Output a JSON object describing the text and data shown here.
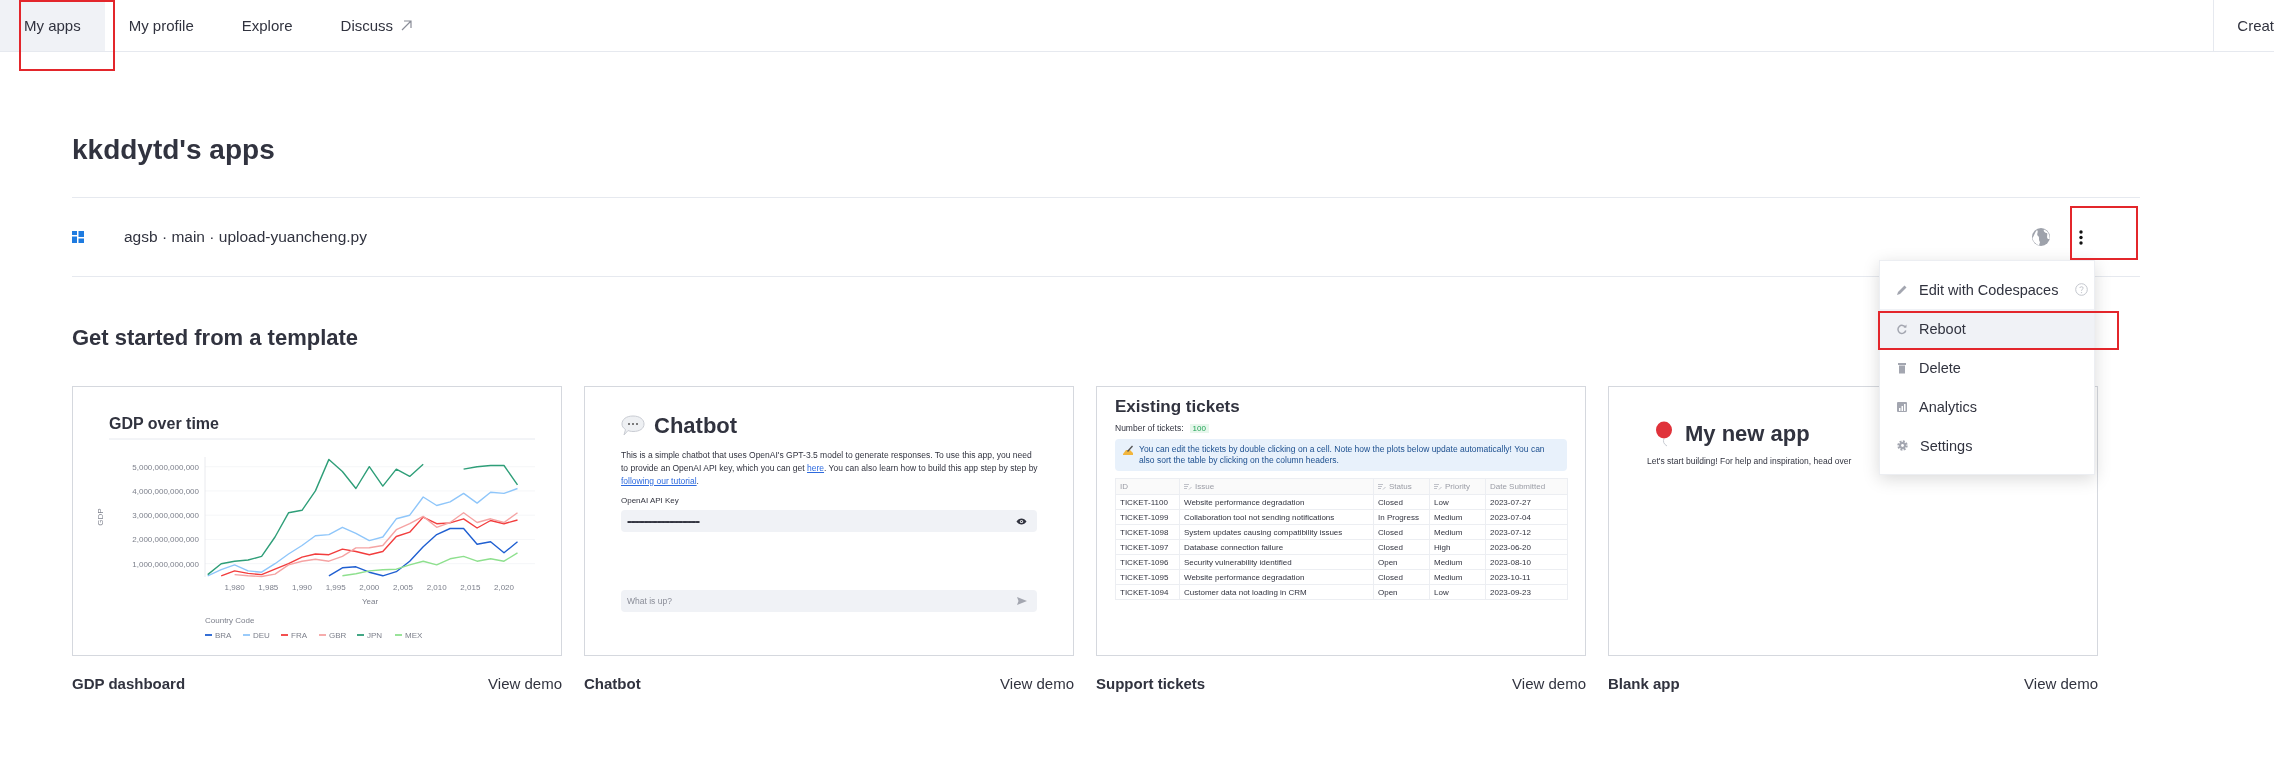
{
  "nav": {
    "tabs": [
      {
        "label": "My apps",
        "kind": "plain",
        "selected": true,
        "highlighted": true
      },
      {
        "label": "My profile",
        "kind": "plain",
        "selected": false,
        "highlighted": false
      },
      {
        "label": "Explore",
        "kind": "plain",
        "selected": false,
        "highlighted": false
      },
      {
        "label": "Discuss",
        "kind": "external",
        "selected": false,
        "highlighted": false
      }
    ],
    "create_button": "Creat"
  },
  "title": "kkddytd's apps",
  "apps": [
    {
      "name": "agsb · main · upload-yuancheng.py",
      "menu_highlighted": true
    }
  ],
  "app_menu": [
    {
      "kind": "edit",
      "label": "Edit with Codespaces",
      "hovered": false,
      "highlighted": false
    },
    {
      "kind": "reboot",
      "label": "Reboot",
      "hovered": true,
      "highlighted": true
    },
    {
      "kind": "delete",
      "label": "Delete",
      "hovered": false,
      "highlighted": false
    },
    {
      "kind": "analytics",
      "label": "Analytics",
      "hovered": false,
      "highlighted": false
    },
    {
      "kind": "settings",
      "label": "Settings",
      "hovered": false,
      "highlighted": false
    }
  ],
  "templates_title": "Get started from a template",
  "templates": [
    {
      "kind": "chart",
      "name": "GDP dashboard",
      "link": "View demo",
      "legend_title": "Country Code",
      "chart_data": {
        "type": "line",
        "title": "GDP over time",
        "xlabel": "Year",
        "ylabel": "GDP",
        "x": [
          1976,
          1978,
          1980,
          1982,
          1984,
          1986,
          1988,
          1990,
          1992,
          1994,
          1996,
          1998,
          2000,
          2002,
          2004,
          2006,
          2008,
          2010,
          2012,
          2014,
          2016,
          2018,
          2020,
          2022
        ],
        "xlim": [
          1975.6,
          2024.6
        ],
        "ylim": [
          450000000000.0,
          5400000000000.0
        ],
        "grid": true,
        "legend": "bottom",
        "xticks": [
          {
            "value": 1980,
            "label": "1,980"
          },
          {
            "value": 1985,
            "label": "1,985"
          },
          {
            "value": 1990,
            "label": "1,990"
          },
          {
            "value": 1995,
            "label": "1,995"
          },
          {
            "value": 2000,
            "label": "2,000"
          },
          {
            "value": 2005,
            "label": "2,005"
          },
          {
            "value": 2010,
            "label": "2,010"
          },
          {
            "value": 2015,
            "label": "2,015"
          },
          {
            "value": 2020,
            "label": "2,020"
          }
        ],
        "yticks": [
          {
            "value": 1000000000000.0,
            "label": "1,000,000,000,000"
          },
          {
            "value": 2000000000000.0,
            "label": "2,000,000,000,000"
          },
          {
            "value": 3000000000000.0,
            "label": "3,000,000,000,000"
          },
          {
            "value": 4000000000000.0,
            "label": "4,000,000,000,000"
          },
          {
            "value": 5000000000000.0,
            "label": "5,000,000,000,000"
          }
        ],
        "series": [
          {
            "name": "BRA",
            "color": "#1f5fd1",
            "values": [
              null,
              null,
              null,
              null,
              null,
              null,
              null,
              null,
              null,
              500000000000.0,
              830000000000.0,
              870000000000.0,
              650000000000.0,
              500000000000.0,
              670000000000.0,
              1100000000000.0,
              1700000000000.0,
              2200000000000.0,
              2450000000000.0,
              2450000000000.0,
              1800000000000.0,
              1900000000000.0,
              1450000000000.0,
              1900000000000.0
            ]
          },
          {
            "name": "DEU",
            "color": "#8fc6fa",
            "values": [
              500000000000.0,
              750000000000.0,
              950000000000.0,
              700000000000.0,
              650000000000.0,
              1000000000000.0,
              1400000000000.0,
              1750000000000.0,
              2150000000000.0,
              2200000000000.0,
              2500000000000.0,
              2250000000000.0,
              1950000000000.0,
              2100000000000.0,
              2850000000000.0,
              3000000000000.0,
              3750000000000.0,
              3400000000000.0,
              3550000000000.0,
              3900000000000.0,
              3500000000000.0,
              3950000000000.0,
              3900000000000.0,
              4100000000000.0
            ]
          },
          {
            "name": "FRA",
            "color": "#f23d3d",
            "values": [
              null,
              500000000000.0,
              700000000000.0,
              600000000000.0,
              550000000000.0,
              770000000000.0,
              1000000000000.0,
              1270000000000.0,
              1400000000000.0,
              1370000000000.0,
              1600000000000.0,
              1500000000000.0,
              1370000000000.0,
              1500000000000.0,
              2120000000000.0,
              2300000000000.0,
              2920000000000.0,
              2650000000000.0,
              2680000000000.0,
              2850000000000.0,
              2470000000000.0,
              2780000000000.0,
              2650000000000.0,
              2800000000000.0
            ]
          },
          {
            "name": "GBR",
            "color": "#f5a3a3",
            "values": [
              null,
              null,
              550000000000.0,
              500000000000.0,
              470000000000.0,
              570000000000.0,
              950000000000.0,
              1100000000000.0,
              1180000000000.0,
              1100000000000.0,
              1300000000000.0,
              1650000000000.0,
              1660000000000.0,
              1750000000000.0,
              2400000000000.0,
              2650000000000.0,
              2950000000000.0,
              2500000000000.0,
              2700000000000.0,
              3100000000000.0,
              2700000000000.0,
              2850000000000.0,
              2700000000000.0,
              3100000000000.0
            ]
          },
          {
            "name": "JPN",
            "color": "#2e9e78",
            "values": [
              550000000000.0,
              1000000000000.0,
              1100000000000.0,
              1150000000000.0,
              1300000000000.0,
              2100000000000.0,
              3100000000000.0,
              3200000000000.0,
              4000000000000.0,
              5300000000000.0,
              4800000000000.0,
              4100000000000.0,
              5000000000000.0,
              4200000000000.0,
              4900000000000.0,
              4600000000000.0,
              5100000000000.0,
              null,
              null,
              4900000000000.0,
              5000000000000.0,
              5050000000000.0,
              5050000000000.0,
              4250000000000.0
            ]
          },
          {
            "name": "MEX",
            "color": "#8ee08e",
            "values": [
              null,
              null,
              null,
              null,
              null,
              null,
              null,
              null,
              null,
              null,
              500000000000.0,
              580000000000.0,
              700000000000.0,
              750000000000.0,
              770000000000.0,
              950000000000.0,
              1100000000000.0,
              950000000000.0,
              1200000000000.0,
              1300000000000.0,
              1100000000000.0,
              1200000000000.0,
              1100000000000.0,
              1450000000000.0
            ]
          }
        ]
      }
    },
    {
      "kind": "chatbot",
      "name": "Chatbot",
      "link": "View demo",
      "preview": {
        "title": "Chatbot",
        "description": [
          {
            "text": "This is a simple chatbot that uses OpenAI's GPT-3.5 model to generate responses. To use this app, you need to provide an OpenAI API key, which you can get ",
            "link": false
          },
          {
            "text": "here",
            "link": true
          },
          {
            "text": ". You can also learn how to build this app step by step by ",
            "link": false
          },
          {
            "text": "following our tutorial",
            "link": true
          },
          {
            "text": ".",
            "link": false
          }
        ],
        "key_label": "OpenAI API Key",
        "key_value": "•••••••••••••••••••••••••••••••••••••••••••••••••••••••",
        "chat_placeholder": "What is up?"
      }
    },
    {
      "kind": "tickets",
      "name": "Support tickets",
      "link": "View demo",
      "preview": {
        "title": "Existing tickets",
        "count_label": "Number of tickets:",
        "count": "100",
        "info": "You can edit the tickets by double clicking on a cell. Note how the plots below update automatically! You can also sort the table by clicking on the column headers.",
        "columns": [
          {
            "label": "ID",
            "editable": false
          },
          {
            "label": "Issue",
            "editable": true
          },
          {
            "label": "Status",
            "editable": true
          },
          {
            "label": "Priority",
            "editable": true
          },
          {
            "label": "Date Submitted",
            "editable": false
          }
        ],
        "rows": [
          [
            "TICKET-1100",
            "Website performance degradation",
            "Closed",
            "Low",
            "2023-07-27"
          ],
          [
            "TICKET-1099",
            "Collaboration tool not sending notifications",
            "In Progress",
            "Medium",
            "2023-07-04"
          ],
          [
            "TICKET-1098",
            "System updates causing compatibility issues",
            "Closed",
            "Medium",
            "2023-07-12"
          ],
          [
            "TICKET-1097",
            "Database connection failure",
            "Closed",
            "High",
            "2023-06-20"
          ],
          [
            "TICKET-1096",
            "Security vulnerability identified",
            "Open",
            "Medium",
            "2023-08-10"
          ],
          [
            "TICKET-1095",
            "Website performance degradation",
            "Closed",
            "Medium",
            "2023-10-11"
          ],
          [
            "TICKET-1094",
            "Customer data not loading in CRM",
            "Open",
            "Low",
            "2023-09-23"
          ]
        ]
      }
    },
    {
      "kind": "blank",
      "name": "Blank app",
      "link": "View demo",
      "preview": {
        "title": "My new app",
        "text": "Let's start building! For help and inspiration, head over"
      }
    }
  ]
}
